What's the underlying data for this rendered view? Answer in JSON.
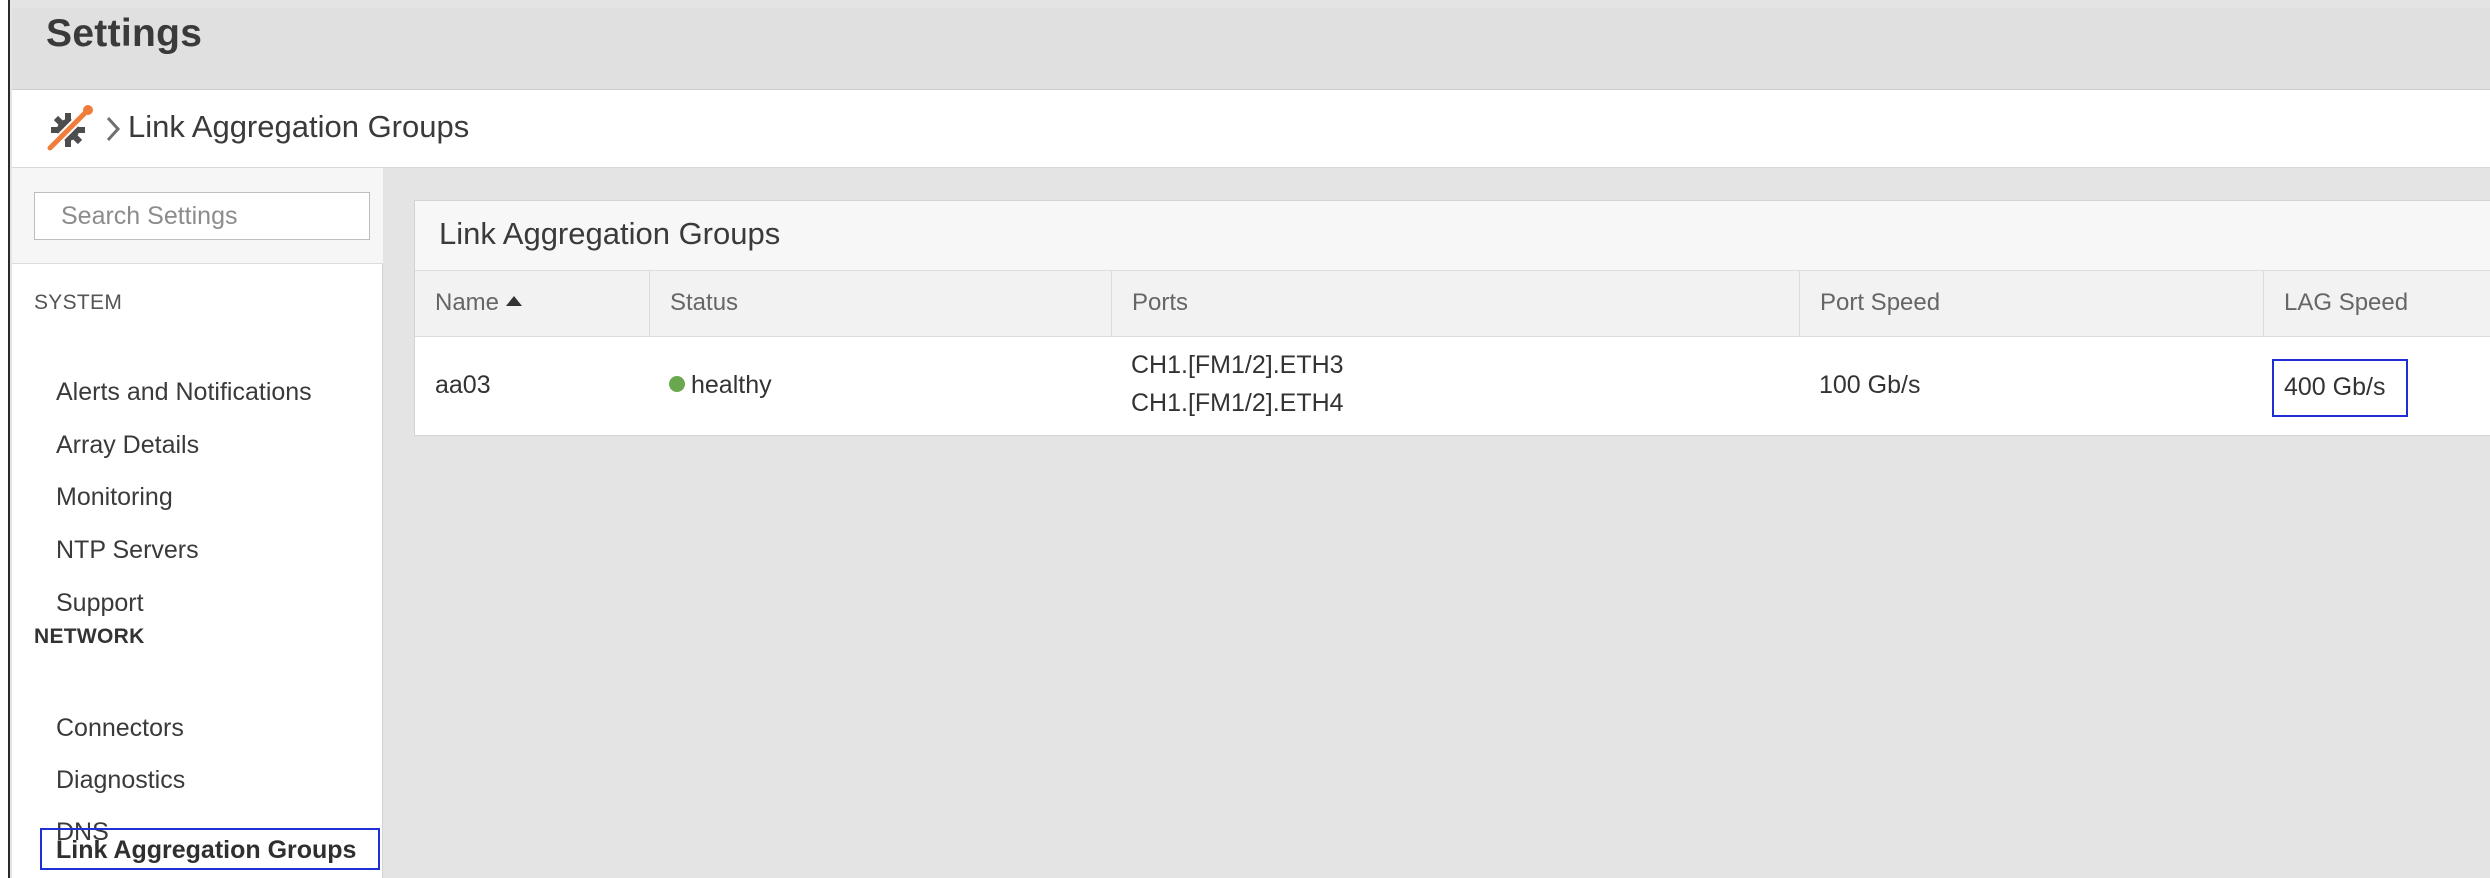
{
  "header": {
    "title": "Settings"
  },
  "breadcrumb": {
    "logo_icon": "gear-tools-icon",
    "separator_icon": "chevron-right-icon",
    "current": "Link Aggregation Groups"
  },
  "sidebar": {
    "search": {
      "placeholder": "Search Settings",
      "value": ""
    },
    "sections": [
      {
        "label": "SYSTEM",
        "items": [
          {
            "label": "Alerts and Notifications"
          },
          {
            "label": "Array Details"
          },
          {
            "label": "Monitoring"
          },
          {
            "label": "NTP Servers"
          },
          {
            "label": "Support"
          }
        ]
      },
      {
        "label": "NETWORK",
        "items": [
          {
            "label": "Connectors"
          },
          {
            "label": "Diagnostics"
          },
          {
            "label": "DNS"
          },
          {
            "label": "Link Aggregation Groups",
            "active": true
          }
        ]
      }
    ]
  },
  "panel": {
    "title": "Link Aggregation Groups",
    "columns": [
      "Name",
      "Status",
      "Ports",
      "Port Speed",
      "LAG Speed"
    ],
    "sort": {
      "column": "Name",
      "direction": "ascending",
      "icon": "sort-ascending-icon"
    },
    "rows": [
      {
        "name": "aa03",
        "status": "healthy",
        "status_color": "#6aa84f",
        "ports": [
          "CH1.[FM1/2].ETH3",
          "CH1.[FM1/2].ETH4"
        ],
        "port_speed": "100 Gb/s",
        "lag_speed": "400 Gb/s"
      }
    ]
  },
  "colors": {
    "highlight": "#1f2fd6",
    "healthy": "#6aa84f"
  }
}
